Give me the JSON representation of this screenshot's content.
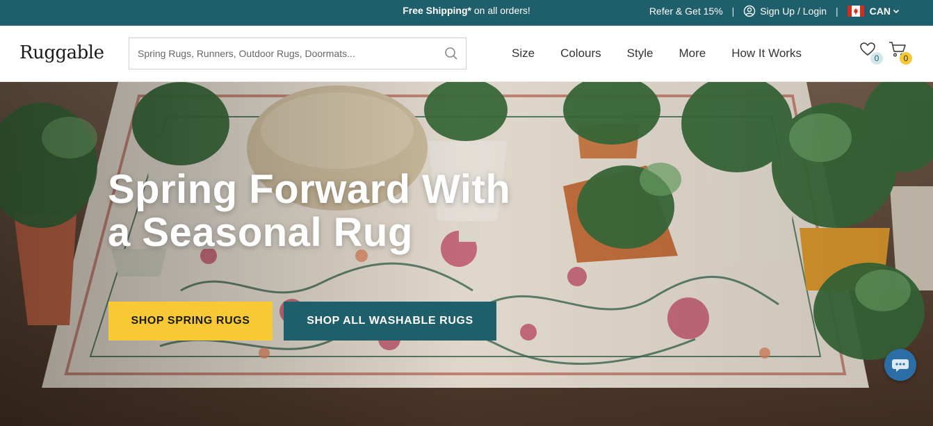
{
  "topbar": {
    "promo_bold": "Free Shipping*",
    "promo_rest": " on all orders!",
    "refer": "Refer & Get 15%",
    "separator": "|",
    "account": "Sign Up / Login",
    "country": "CAN"
  },
  "header": {
    "logo": "Ruggable",
    "search": {
      "placeholder": "Spring Rugs, Runners, Outdoor Rugs, Doormats..."
    },
    "nav": [
      "Size",
      "Colours",
      "Style",
      "More",
      "How It Works"
    ],
    "wishlist_count": "0",
    "cart_count": "0"
  },
  "hero": {
    "title_line1": "Spring Forward With",
    "title_line2": "a Seasonal Rug",
    "button_primary": "SHOP SPRING RUGS",
    "button_secondary": "SHOP ALL WASHABLE RUGS"
  },
  "icons": {
    "account": "user-circle-icon",
    "flag": "canada-flag-icon",
    "dropdown": "chevron-down-icon",
    "search": "search-icon",
    "wishlist": "heart-icon",
    "cart": "cart-icon",
    "chat": "chat-icon"
  },
  "colors": {
    "brand_teal": "#1f5f6b",
    "accent_yellow": "#f7c934",
    "white": "#ffffff",
    "text_dark": "#333333"
  }
}
